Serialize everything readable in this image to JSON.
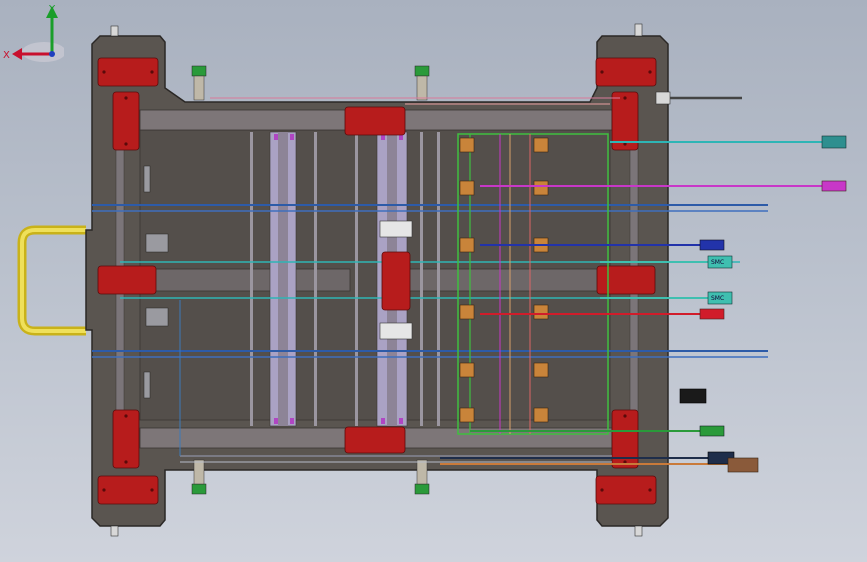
{
  "viewport": {
    "background_top": "#a9b1bf",
    "background_bottom": "#cfd3dc"
  },
  "model": {
    "frame_color": "#5a5550",
    "frame_edge": "#2b2826",
    "pad_color": "#b71c1c",
    "rail_color": "#8d8790",
    "guide_color": "#b0a8c8",
    "handle_color": "#e8d23a",
    "hoses": [
      {
        "color": "#2eb5b5"
      },
      {
        "color": "#c837c8"
      },
      {
        "color": "#2233aa"
      },
      {
        "color": "#3fbfb0"
      },
      {
        "color": "#d11c2a"
      },
      {
        "color": "#1e2d4a"
      },
      {
        "color": "#2a9a3a"
      },
      {
        "color": "#c97a3a"
      }
    ],
    "valve_tags": [
      {
        "text": "SMC"
      },
      {
        "text": "SMC"
      }
    ]
  },
  "triad": {
    "x_label": "X",
    "y_label": "Y",
    "x_color": "#c8102e",
    "y_color": "#1a9e2a",
    "z_color": "#1f3fbf"
  }
}
